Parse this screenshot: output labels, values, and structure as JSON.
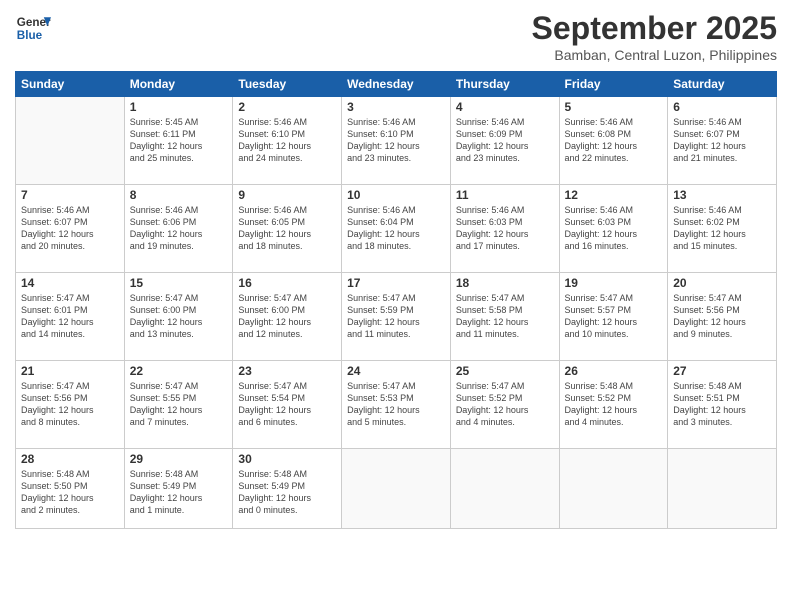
{
  "header": {
    "logo_line1": "General",
    "logo_line2": "Blue",
    "month": "September 2025",
    "location": "Bamban, Central Luzon, Philippines"
  },
  "weekdays": [
    "Sunday",
    "Monday",
    "Tuesday",
    "Wednesday",
    "Thursday",
    "Friday",
    "Saturday"
  ],
  "weeks": [
    [
      {
        "day": "",
        "text": ""
      },
      {
        "day": "1",
        "text": "Sunrise: 5:45 AM\nSunset: 6:11 PM\nDaylight: 12 hours\nand 25 minutes."
      },
      {
        "day": "2",
        "text": "Sunrise: 5:46 AM\nSunset: 6:10 PM\nDaylight: 12 hours\nand 24 minutes."
      },
      {
        "day": "3",
        "text": "Sunrise: 5:46 AM\nSunset: 6:10 PM\nDaylight: 12 hours\nand 23 minutes."
      },
      {
        "day": "4",
        "text": "Sunrise: 5:46 AM\nSunset: 6:09 PM\nDaylight: 12 hours\nand 23 minutes."
      },
      {
        "day": "5",
        "text": "Sunrise: 5:46 AM\nSunset: 6:08 PM\nDaylight: 12 hours\nand 22 minutes."
      },
      {
        "day": "6",
        "text": "Sunrise: 5:46 AM\nSunset: 6:07 PM\nDaylight: 12 hours\nand 21 minutes."
      }
    ],
    [
      {
        "day": "7",
        "text": "Sunrise: 5:46 AM\nSunset: 6:07 PM\nDaylight: 12 hours\nand 20 minutes."
      },
      {
        "day": "8",
        "text": "Sunrise: 5:46 AM\nSunset: 6:06 PM\nDaylight: 12 hours\nand 19 minutes."
      },
      {
        "day": "9",
        "text": "Sunrise: 5:46 AM\nSunset: 6:05 PM\nDaylight: 12 hours\nand 18 minutes."
      },
      {
        "day": "10",
        "text": "Sunrise: 5:46 AM\nSunset: 6:04 PM\nDaylight: 12 hours\nand 18 minutes."
      },
      {
        "day": "11",
        "text": "Sunrise: 5:46 AM\nSunset: 6:03 PM\nDaylight: 12 hours\nand 17 minutes."
      },
      {
        "day": "12",
        "text": "Sunrise: 5:46 AM\nSunset: 6:03 PM\nDaylight: 12 hours\nand 16 minutes."
      },
      {
        "day": "13",
        "text": "Sunrise: 5:46 AM\nSunset: 6:02 PM\nDaylight: 12 hours\nand 15 minutes."
      }
    ],
    [
      {
        "day": "14",
        "text": "Sunrise: 5:47 AM\nSunset: 6:01 PM\nDaylight: 12 hours\nand 14 minutes."
      },
      {
        "day": "15",
        "text": "Sunrise: 5:47 AM\nSunset: 6:00 PM\nDaylight: 12 hours\nand 13 minutes."
      },
      {
        "day": "16",
        "text": "Sunrise: 5:47 AM\nSunset: 6:00 PM\nDaylight: 12 hours\nand 12 minutes."
      },
      {
        "day": "17",
        "text": "Sunrise: 5:47 AM\nSunset: 5:59 PM\nDaylight: 12 hours\nand 11 minutes."
      },
      {
        "day": "18",
        "text": "Sunrise: 5:47 AM\nSunset: 5:58 PM\nDaylight: 12 hours\nand 11 minutes."
      },
      {
        "day": "19",
        "text": "Sunrise: 5:47 AM\nSunset: 5:57 PM\nDaylight: 12 hours\nand 10 minutes."
      },
      {
        "day": "20",
        "text": "Sunrise: 5:47 AM\nSunset: 5:56 PM\nDaylight: 12 hours\nand 9 minutes."
      }
    ],
    [
      {
        "day": "21",
        "text": "Sunrise: 5:47 AM\nSunset: 5:56 PM\nDaylight: 12 hours\nand 8 minutes."
      },
      {
        "day": "22",
        "text": "Sunrise: 5:47 AM\nSunset: 5:55 PM\nDaylight: 12 hours\nand 7 minutes."
      },
      {
        "day": "23",
        "text": "Sunrise: 5:47 AM\nSunset: 5:54 PM\nDaylight: 12 hours\nand 6 minutes."
      },
      {
        "day": "24",
        "text": "Sunrise: 5:47 AM\nSunset: 5:53 PM\nDaylight: 12 hours\nand 5 minutes."
      },
      {
        "day": "25",
        "text": "Sunrise: 5:47 AM\nSunset: 5:52 PM\nDaylight: 12 hours\nand 4 minutes."
      },
      {
        "day": "26",
        "text": "Sunrise: 5:48 AM\nSunset: 5:52 PM\nDaylight: 12 hours\nand 4 minutes."
      },
      {
        "day": "27",
        "text": "Sunrise: 5:48 AM\nSunset: 5:51 PM\nDaylight: 12 hours\nand 3 minutes."
      }
    ],
    [
      {
        "day": "28",
        "text": "Sunrise: 5:48 AM\nSunset: 5:50 PM\nDaylight: 12 hours\nand 2 minutes."
      },
      {
        "day": "29",
        "text": "Sunrise: 5:48 AM\nSunset: 5:49 PM\nDaylight: 12 hours\nand 1 minute."
      },
      {
        "day": "30",
        "text": "Sunrise: 5:48 AM\nSunset: 5:49 PM\nDaylight: 12 hours\nand 0 minutes."
      },
      {
        "day": "",
        "text": ""
      },
      {
        "day": "",
        "text": ""
      },
      {
        "day": "",
        "text": ""
      },
      {
        "day": "",
        "text": ""
      }
    ]
  ]
}
